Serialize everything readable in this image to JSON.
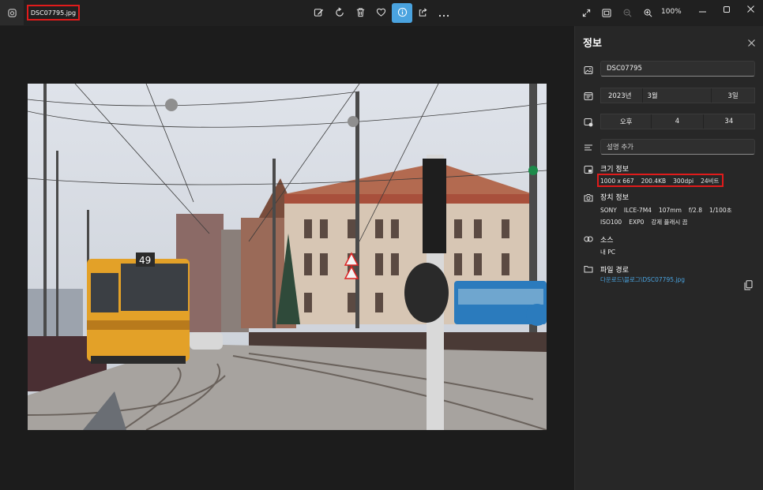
{
  "titlebar": {
    "file_name": "DSC07795.jpg"
  },
  "toolbar": {
    "tools": [
      "edit-icon",
      "rotate-icon",
      "delete-icon",
      "favorite-icon",
      "info-icon",
      "share-icon",
      "more-icon"
    ],
    "active_tool": "info-icon",
    "zoom_level": "100%"
  },
  "panel": {
    "title": "정보",
    "name_field": "DSC07795",
    "date": {
      "year": "2023년",
      "month": "3월",
      "day": "3일"
    },
    "time": {
      "ampm": "오후",
      "hour": "4",
      "minute": "34"
    },
    "caption_placeholder": "설명 추가",
    "size_info": {
      "label": "크기 정보",
      "dimensions": "1000 x 667",
      "filesize": "200.4KB",
      "dpi": "300dpi",
      "bitdepth": "24비트"
    },
    "device_info": {
      "label": "장치 정보",
      "make": "SONY",
      "model": "ILCE-7M4",
      "focal": "107mm",
      "aperture": "f/2.8",
      "shutter": "1/100초",
      "iso": "ISO100",
      "exposure": "EXP0",
      "flash": "강제 플래시 끔"
    },
    "source": {
      "label": "소스",
      "value": "내 PC"
    },
    "file_path": {
      "label": "파일 경로",
      "value": "다운로드\\블로그\\DSC07795.jpg"
    }
  },
  "colors": {
    "accent": "#4aa3df",
    "highlight_box": "#e01b1b",
    "background": "#1c1c1c",
    "panel": "#272727"
  }
}
